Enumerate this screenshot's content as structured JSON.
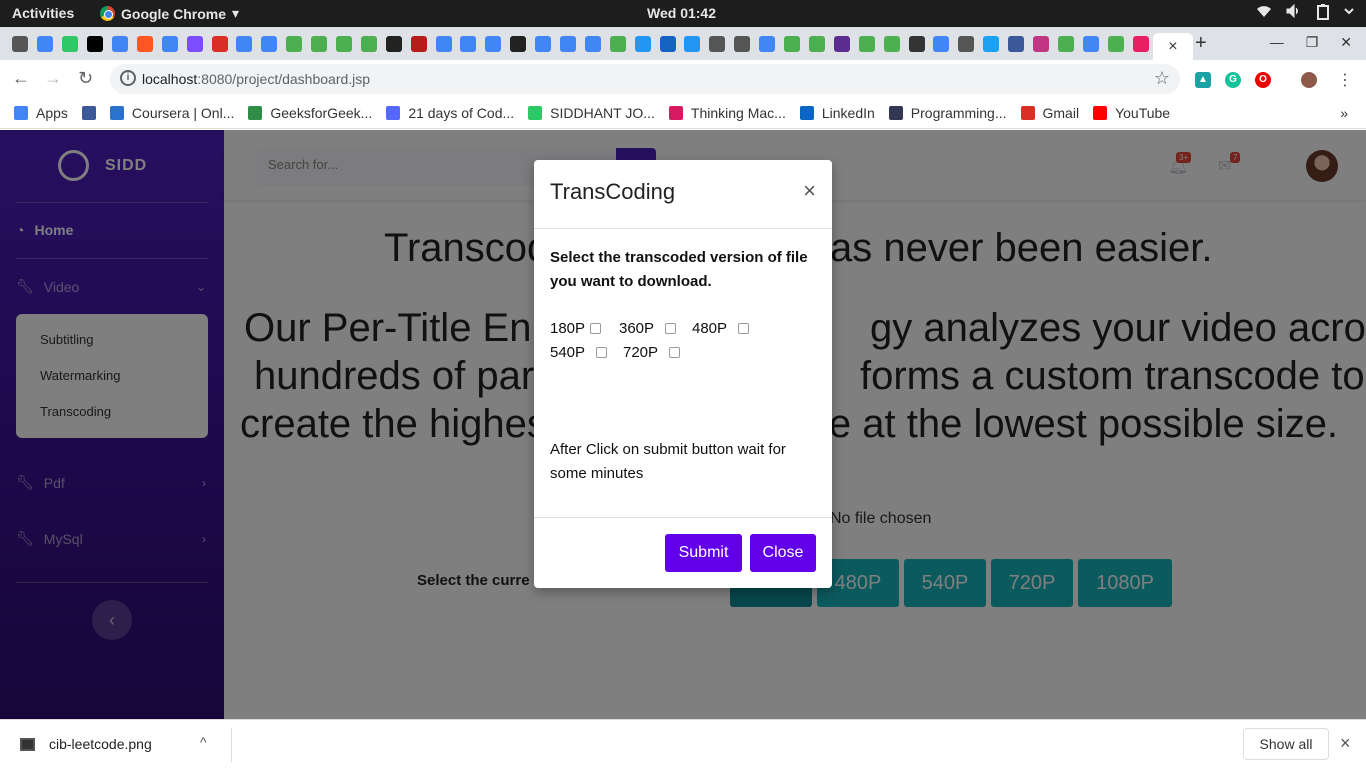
{
  "system": {
    "activities": "Activities",
    "app_name": "Google Chrome",
    "app_menu_arrow": "▾",
    "clock": "Wed 01:42"
  },
  "browser": {
    "url_host": "localhost",
    "url_rest": ":8080/project/dashboard.jsp",
    "tab_close": "×",
    "new_tab": "+",
    "bookmarks": [
      {
        "label": "Apps",
        "icon": "apps-grid",
        "color": "#4285f4"
      },
      {
        "label": "",
        "icon": "facebook",
        "color": "#3b5998"
      },
      {
        "label": "Coursera | Onl...",
        "icon": "coursera",
        "color": "#2a73cc"
      },
      {
        "label": "GeeksforGeek...",
        "icon": "geeksforgeeks",
        "color": "#2f8d46"
      },
      {
        "label": "21 days of Cod...",
        "icon": "lightning",
        "color": "#5468ff"
      },
      {
        "label": "SIDDHANT JO...",
        "icon": "hackerrank",
        "color": "#2ec866"
      },
      {
        "label": "Thinking Mac...",
        "icon": "flower",
        "color": "#d81b60"
      },
      {
        "label": "LinkedIn",
        "icon": "linkedin",
        "color": "#0a66c2"
      },
      {
        "label": "Programming...",
        "icon": "hackerearth",
        "color": "#323754"
      },
      {
        "label": "Gmail",
        "icon": "gmail",
        "color": "#d93025"
      },
      {
        "label": "YouTube",
        "icon": "youtube",
        "color": "#ff0000"
      }
    ],
    "bookmarks_more": "»"
  },
  "sidebar": {
    "brand": "SIDD",
    "home": "Home",
    "video": "Video",
    "sub_items": [
      "Subtitling",
      "Watermarking",
      "Transcoding"
    ],
    "pdf": "Pdf",
    "mysql": "MySql",
    "toggle": "‹"
  },
  "topnav": {
    "search_placeholder": "Search for...",
    "alerts_count": "3+",
    "messages_count": "7"
  },
  "main": {
    "heading1_left": "Transcod",
    "heading1_right": "as never been easier.",
    "heading2_line1_left": "Our Per-Title En",
    "heading2_line1_right": "gy analyzes your video across",
    "heading2_line2_left": "hundreds of par",
    "heading2_line2_right": "forms a custom transcode to",
    "heading2_line3_left": "create the highes",
    "heading2_line3_right": "le at the lowest possible size.",
    "file_status": "No file chosen",
    "select_label": "Select the curre",
    "resolutions": [
      "480P",
      "540P",
      "720P",
      "1080P"
    ]
  },
  "modal": {
    "title": "TransCoding",
    "close_glyph": "×",
    "instruction": "Select the transcoded version of file you want to download.",
    "options": [
      "180P",
      "360P",
      "480P",
      "540P",
      "720P"
    ],
    "note": "After Click on submit button wait for some minutes",
    "submit": "Submit",
    "close": "Close"
  },
  "downloads": {
    "file": "cib-leetcode.png",
    "chevron": "^",
    "show_all": "Show all",
    "close": "×"
  },
  "colors": {
    "sidebar": "#4e1fc0",
    "modal_button": "#6200ea",
    "resolution_button": "#16b4bd"
  }
}
